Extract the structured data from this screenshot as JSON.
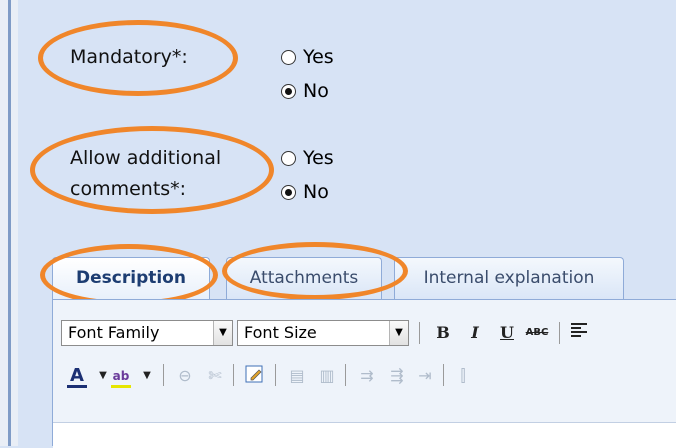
{
  "fields": {
    "mandatory": {
      "label": "Mandatory*:",
      "options": [
        {
          "label": "Yes",
          "checked": false
        },
        {
          "label": "No",
          "checked": true
        }
      ]
    },
    "allow_comments": {
      "label_line1": "Allow additional",
      "label_line2": "comments*:",
      "options": [
        {
          "label": "Yes",
          "checked": false
        },
        {
          "label": "No",
          "checked": true
        }
      ]
    }
  },
  "tabs": [
    {
      "label": "Description",
      "active": true
    },
    {
      "label": "Attachments",
      "active": false
    },
    {
      "label": "Internal explanation",
      "active": false
    }
  ],
  "toolbar": {
    "font_family": "Font Family",
    "font_size": "Font Size",
    "bold": "B",
    "italic": "I",
    "underline": "U",
    "strikethrough": "ABC",
    "row1_icons": [
      "bold-icon",
      "italic-icon",
      "underline-icon",
      "strikethrough-icon",
      "align-left-icon"
    ],
    "row2_icons": [
      "text-color-icon",
      "highlight-color-icon",
      "link-icon",
      "unlink-icon",
      "edit-icon",
      "table-icon",
      "table-props-icon",
      "insert-row-before-icon",
      "insert-row-after-icon",
      "delete-row-icon",
      "insert-col-icon"
    ]
  },
  "annotation_color": "#f0862a"
}
